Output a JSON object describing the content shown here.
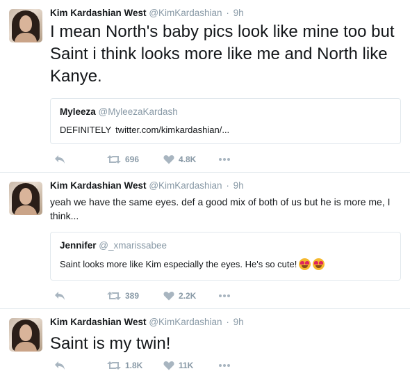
{
  "tweets": [
    {
      "author_name": "Kim Kardashian West",
      "author_handle": "@KimKardashian",
      "separator": "·",
      "time": "9h",
      "text": "I mean North's baby pics look like mine too but Saint i think looks more like me and North like Kanye.",
      "quote": {
        "name": "Myleeza",
        "handle": "@MyleezaKardash",
        "text": "DEFINITELY",
        "link": "twitter.com/kimkardashian/..."
      },
      "actions": {
        "retweets": "696",
        "likes": "4.8K"
      }
    },
    {
      "author_name": "Kim Kardashian West",
      "author_handle": "@KimKardashian",
      "separator": "·",
      "time": "9h",
      "text": "yeah we have the same eyes. def a good mix of both of us but he is more me, I think...",
      "quote": {
        "name": "Jennifer",
        "handle": "@_xmarissabee",
        "text": "Saint looks more like Kim especially the eyes. He's so cute!",
        "emoji": "heart-eyes-emoji"
      },
      "actions": {
        "retweets": "389",
        "likes": "2.2K"
      }
    },
    {
      "author_name": "Kim Kardashian West",
      "author_handle": "@KimKardashian",
      "separator": "·",
      "time": "9h",
      "text": "Saint is my twin!",
      "actions": {
        "retweets": "1.8K",
        "likes": "11K"
      }
    }
  ],
  "icons": {
    "reply": "reply-icon",
    "retweet": "retweet-icon",
    "like": "heart-icon",
    "more": "more-icon"
  },
  "colors": {
    "text": "#14171a",
    "secondary": "#8899a6",
    "border": "#e1e8ed",
    "icon": "#a8b5c0"
  }
}
